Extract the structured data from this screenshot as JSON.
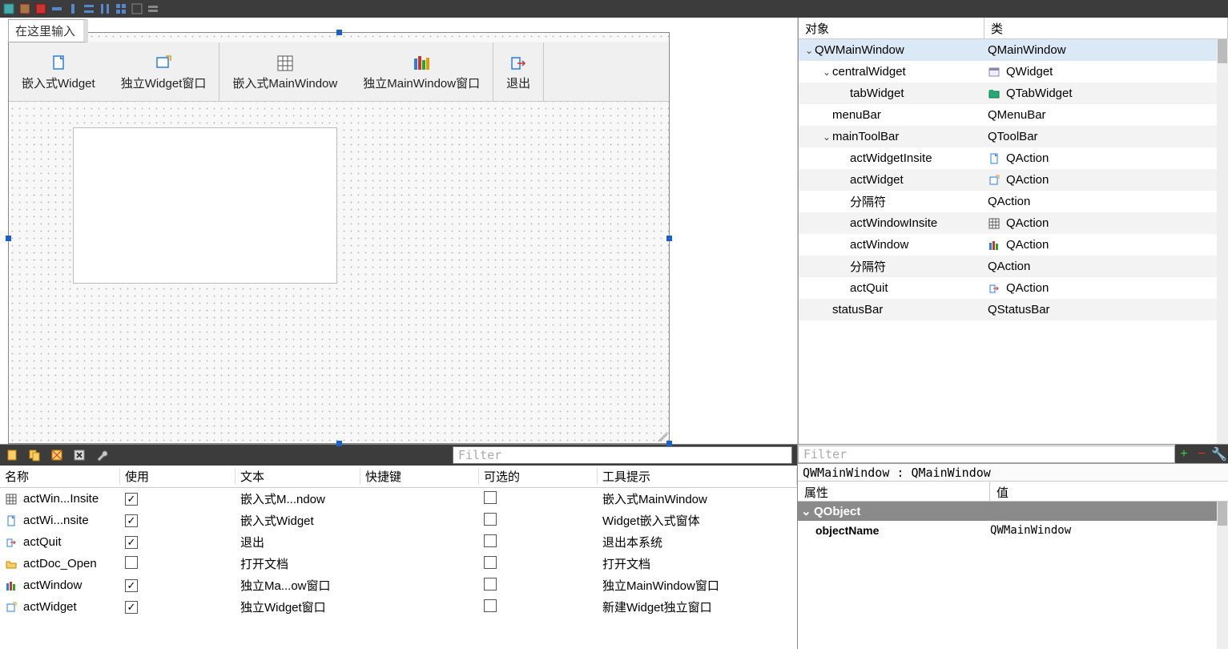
{
  "menu_hint": "在这里输入",
  "toolbar": [
    {
      "label": "嵌入式Widget",
      "icon": "file-icon",
      "color": "#2a7de1"
    },
    {
      "label": "独立Widget窗口",
      "icon": "new-window-icon",
      "color": "#2a7de1"
    },
    {
      "label": "嵌入式MainWindow",
      "icon": "grid-icon",
      "color": "#555"
    },
    {
      "label": "独立MainWindow窗口",
      "icon": "columns-icon",
      "color": "#7a3fb5"
    },
    {
      "label": "退出",
      "icon": "arrow-out-icon",
      "color": "#2a7de1"
    }
  ],
  "object_inspector": {
    "headers": {
      "object": "对象",
      "class": "类"
    },
    "rows": [
      {
        "indent": 0,
        "expand": "open",
        "name": "QWMainWindow",
        "class": "QMainWindow",
        "icon": "",
        "selected": true
      },
      {
        "indent": 1,
        "expand": "open",
        "name": "centralWidget",
        "class": "QWidget",
        "icon": "form-icon"
      },
      {
        "indent": 2,
        "expand": "",
        "name": "tabWidget",
        "class": "QTabWidget",
        "icon": "tab-icon"
      },
      {
        "indent": 1,
        "expand": "",
        "name": "menuBar",
        "class": "QMenuBar",
        "icon": ""
      },
      {
        "indent": 1,
        "expand": "open",
        "name": "mainToolBar",
        "class": "QToolBar",
        "icon": ""
      },
      {
        "indent": 2,
        "expand": "",
        "name": "actWidgetInsite",
        "class": "QAction",
        "icon": "file-icon"
      },
      {
        "indent": 2,
        "expand": "",
        "name": "actWidget",
        "class": "QAction",
        "icon": "new-window-icon"
      },
      {
        "indent": 2,
        "expand": "",
        "name": "分隔符",
        "class": "QAction",
        "icon": ""
      },
      {
        "indent": 2,
        "expand": "",
        "name": "actWindowInsite",
        "class": "QAction",
        "icon": "grid-icon"
      },
      {
        "indent": 2,
        "expand": "",
        "name": "actWindow",
        "class": "QAction",
        "icon": "columns-icon"
      },
      {
        "indent": 2,
        "expand": "",
        "name": "分隔符",
        "class": "QAction",
        "icon": ""
      },
      {
        "indent": 2,
        "expand": "",
        "name": "actQuit",
        "class": "QAction",
        "icon": "arrow-out-icon"
      },
      {
        "indent": 1,
        "expand": "",
        "name": "statusBar",
        "class": "QStatusBar",
        "icon": ""
      }
    ]
  },
  "action_editor": {
    "filter_placeholder": "Filter",
    "headers": {
      "name": "名称",
      "used": "使用",
      "text": "文本",
      "shortcut": "快捷键",
      "checkable": "可选的",
      "tooltip": "工具提示"
    },
    "rows": [
      {
        "icon": "grid-icon",
        "name": "actWin...Insite",
        "used": true,
        "text": "嵌入式M...ndow",
        "shortcut": "",
        "checkable": false,
        "tooltip": "嵌入式MainWindow"
      },
      {
        "icon": "file-icon",
        "name": "actWi...nsite",
        "used": true,
        "text": "嵌入式Widget",
        "shortcut": "",
        "checkable": false,
        "tooltip": "Widget嵌入式窗体"
      },
      {
        "icon": "arrow-out-icon",
        "name": "actQuit",
        "used": true,
        "text": "退出",
        "shortcut": "",
        "checkable": false,
        "tooltip": "退出本系统"
      },
      {
        "icon": "folder-icon",
        "name": "actDoc_Open",
        "used": false,
        "text": "打开文档",
        "shortcut": "",
        "checkable": false,
        "tooltip": "打开文档"
      },
      {
        "icon": "columns-icon",
        "name": "actWindow",
        "used": true,
        "text": "独立Ma...ow窗口",
        "shortcut": "",
        "checkable": false,
        "tooltip": "独立MainWindow窗口"
      },
      {
        "icon": "new-window-icon",
        "name": "actWidget",
        "used": true,
        "text": "独立Widget窗口",
        "shortcut": "",
        "checkable": false,
        "tooltip": "新建Widget独立窗口"
      }
    ]
  },
  "property_editor": {
    "filter_placeholder": "Filter",
    "context": "QWMainWindow : QMainWindow",
    "headers": {
      "prop": "属性",
      "value": "值"
    },
    "group": "QObject",
    "rows": [
      {
        "name": "objectName",
        "value": "QWMainWindow"
      }
    ]
  }
}
